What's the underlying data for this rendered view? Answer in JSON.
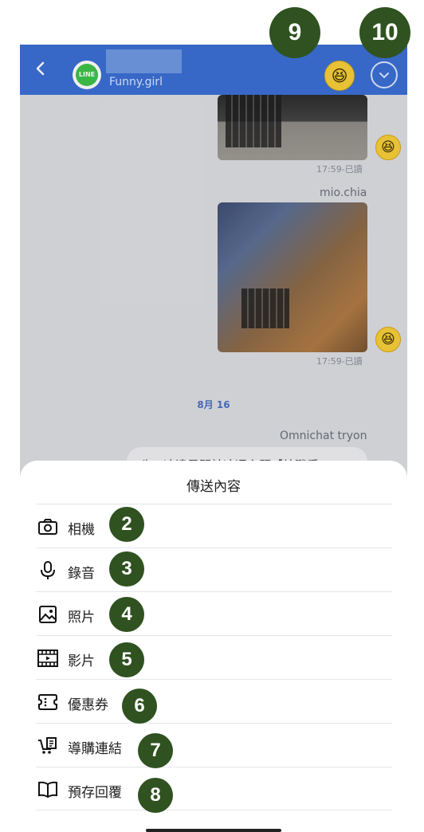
{
  "header": {
    "back_icon": "chevron-left-icon",
    "channel_badge": "LINE",
    "subtitle": "Funny.girl",
    "menu_icon": "chevron-down-circle-icon"
  },
  "chat": {
    "messages": [
      {
        "time": "17:59-已讀"
      },
      {
        "sender": "mio.chia",
        "time": "17:59-已讀"
      }
    ],
    "date_separator": "8月 16",
    "last_sender": "Omnichat tryon",
    "last_text": "嗨，這邊是關於這週主題【站戰爭"
  },
  "sheet": {
    "title": "傳送內容",
    "items": [
      {
        "label": "相機",
        "icon": "camera-icon",
        "marker": "2"
      },
      {
        "label": "錄音",
        "icon": "microphone-icon",
        "marker": "3"
      },
      {
        "label": "照片",
        "icon": "image-icon",
        "marker": "4"
      },
      {
        "label": "影片",
        "icon": "film-icon",
        "marker": "5"
      },
      {
        "label": "優惠券",
        "icon": "coupon-icon",
        "marker": "6"
      },
      {
        "label": "導購連結",
        "icon": "shopping-cart-icon",
        "marker": "7"
      },
      {
        "label": "預存回覆",
        "icon": "book-icon",
        "marker": "8"
      }
    ]
  },
  "markers": {
    "nine": "9",
    "ten": "10"
  },
  "colors": {
    "header": "#3b6fd4",
    "marker": "#2f5220"
  }
}
